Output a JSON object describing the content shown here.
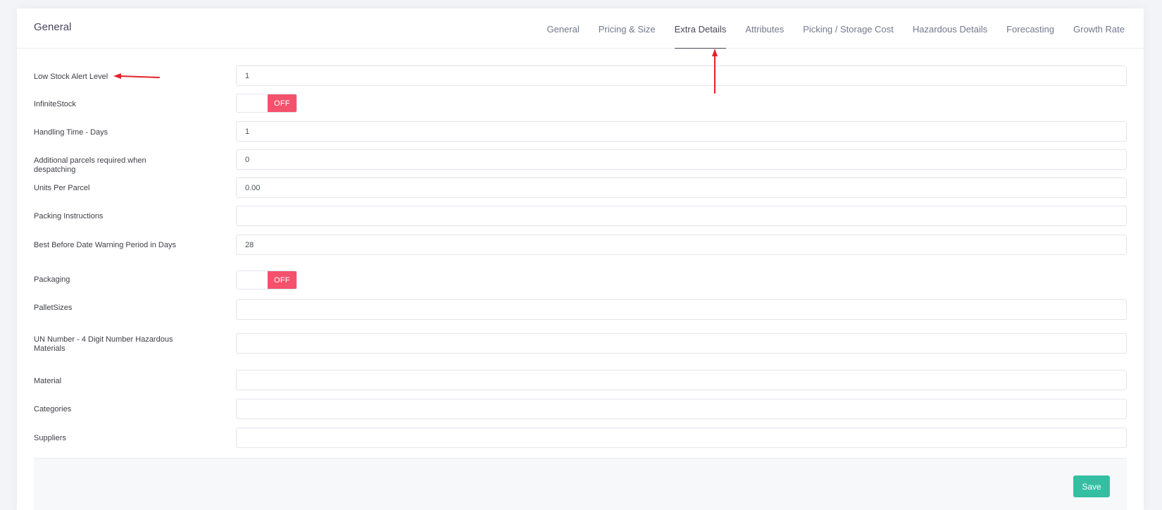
{
  "header": {
    "title": "General"
  },
  "tabs": [
    {
      "label": "General",
      "active": false
    },
    {
      "label": "Pricing & Size",
      "active": false
    },
    {
      "label": "Extra Details",
      "active": true
    },
    {
      "label": "Attributes",
      "active": false
    },
    {
      "label": "Picking / Storage Cost",
      "active": false
    },
    {
      "label": "Hazardous Details",
      "active": false
    },
    {
      "label": "Forecasting",
      "active": false
    },
    {
      "label": "Growth Rate",
      "active": false
    }
  ],
  "form": {
    "low_stock": {
      "label": "Low Stock Alert Level",
      "value": "1"
    },
    "infinite_stock": {
      "label": "InfiniteStock",
      "toggle": "OFF"
    },
    "handling_time": {
      "label": "Handling Time - Days",
      "value": "1"
    },
    "additional_parcels": {
      "label": "Additional parcels required when despatching",
      "value": "0"
    },
    "units_per_parcel": {
      "label": "Units Per Parcel",
      "value": "0.00"
    },
    "packing_instructions": {
      "label": "Packing Instructions",
      "value": ""
    },
    "best_before": {
      "label": "Best Before Date Warning Period in Days",
      "value": "28"
    },
    "packaging": {
      "label": "Packaging",
      "toggle": "OFF"
    },
    "pallet_sizes": {
      "label": "PalletSizes",
      "value": ""
    },
    "un_number": {
      "label": "UN Number - 4 Digit Number Hazardous Materials",
      "value": ""
    },
    "material": {
      "label": "Material",
      "value": ""
    },
    "categories": {
      "label": "Categories",
      "value": ""
    },
    "suppliers": {
      "label": "Suppliers",
      "value": ""
    }
  },
  "footer": {
    "save_label": "Save"
  },
  "colors": {
    "toggle_off": "#f4516c",
    "save_button": "#34bfa3",
    "annotation_arrow": "#e8202a"
  },
  "icons": {
    "annotation": "red-arrow-icon"
  }
}
